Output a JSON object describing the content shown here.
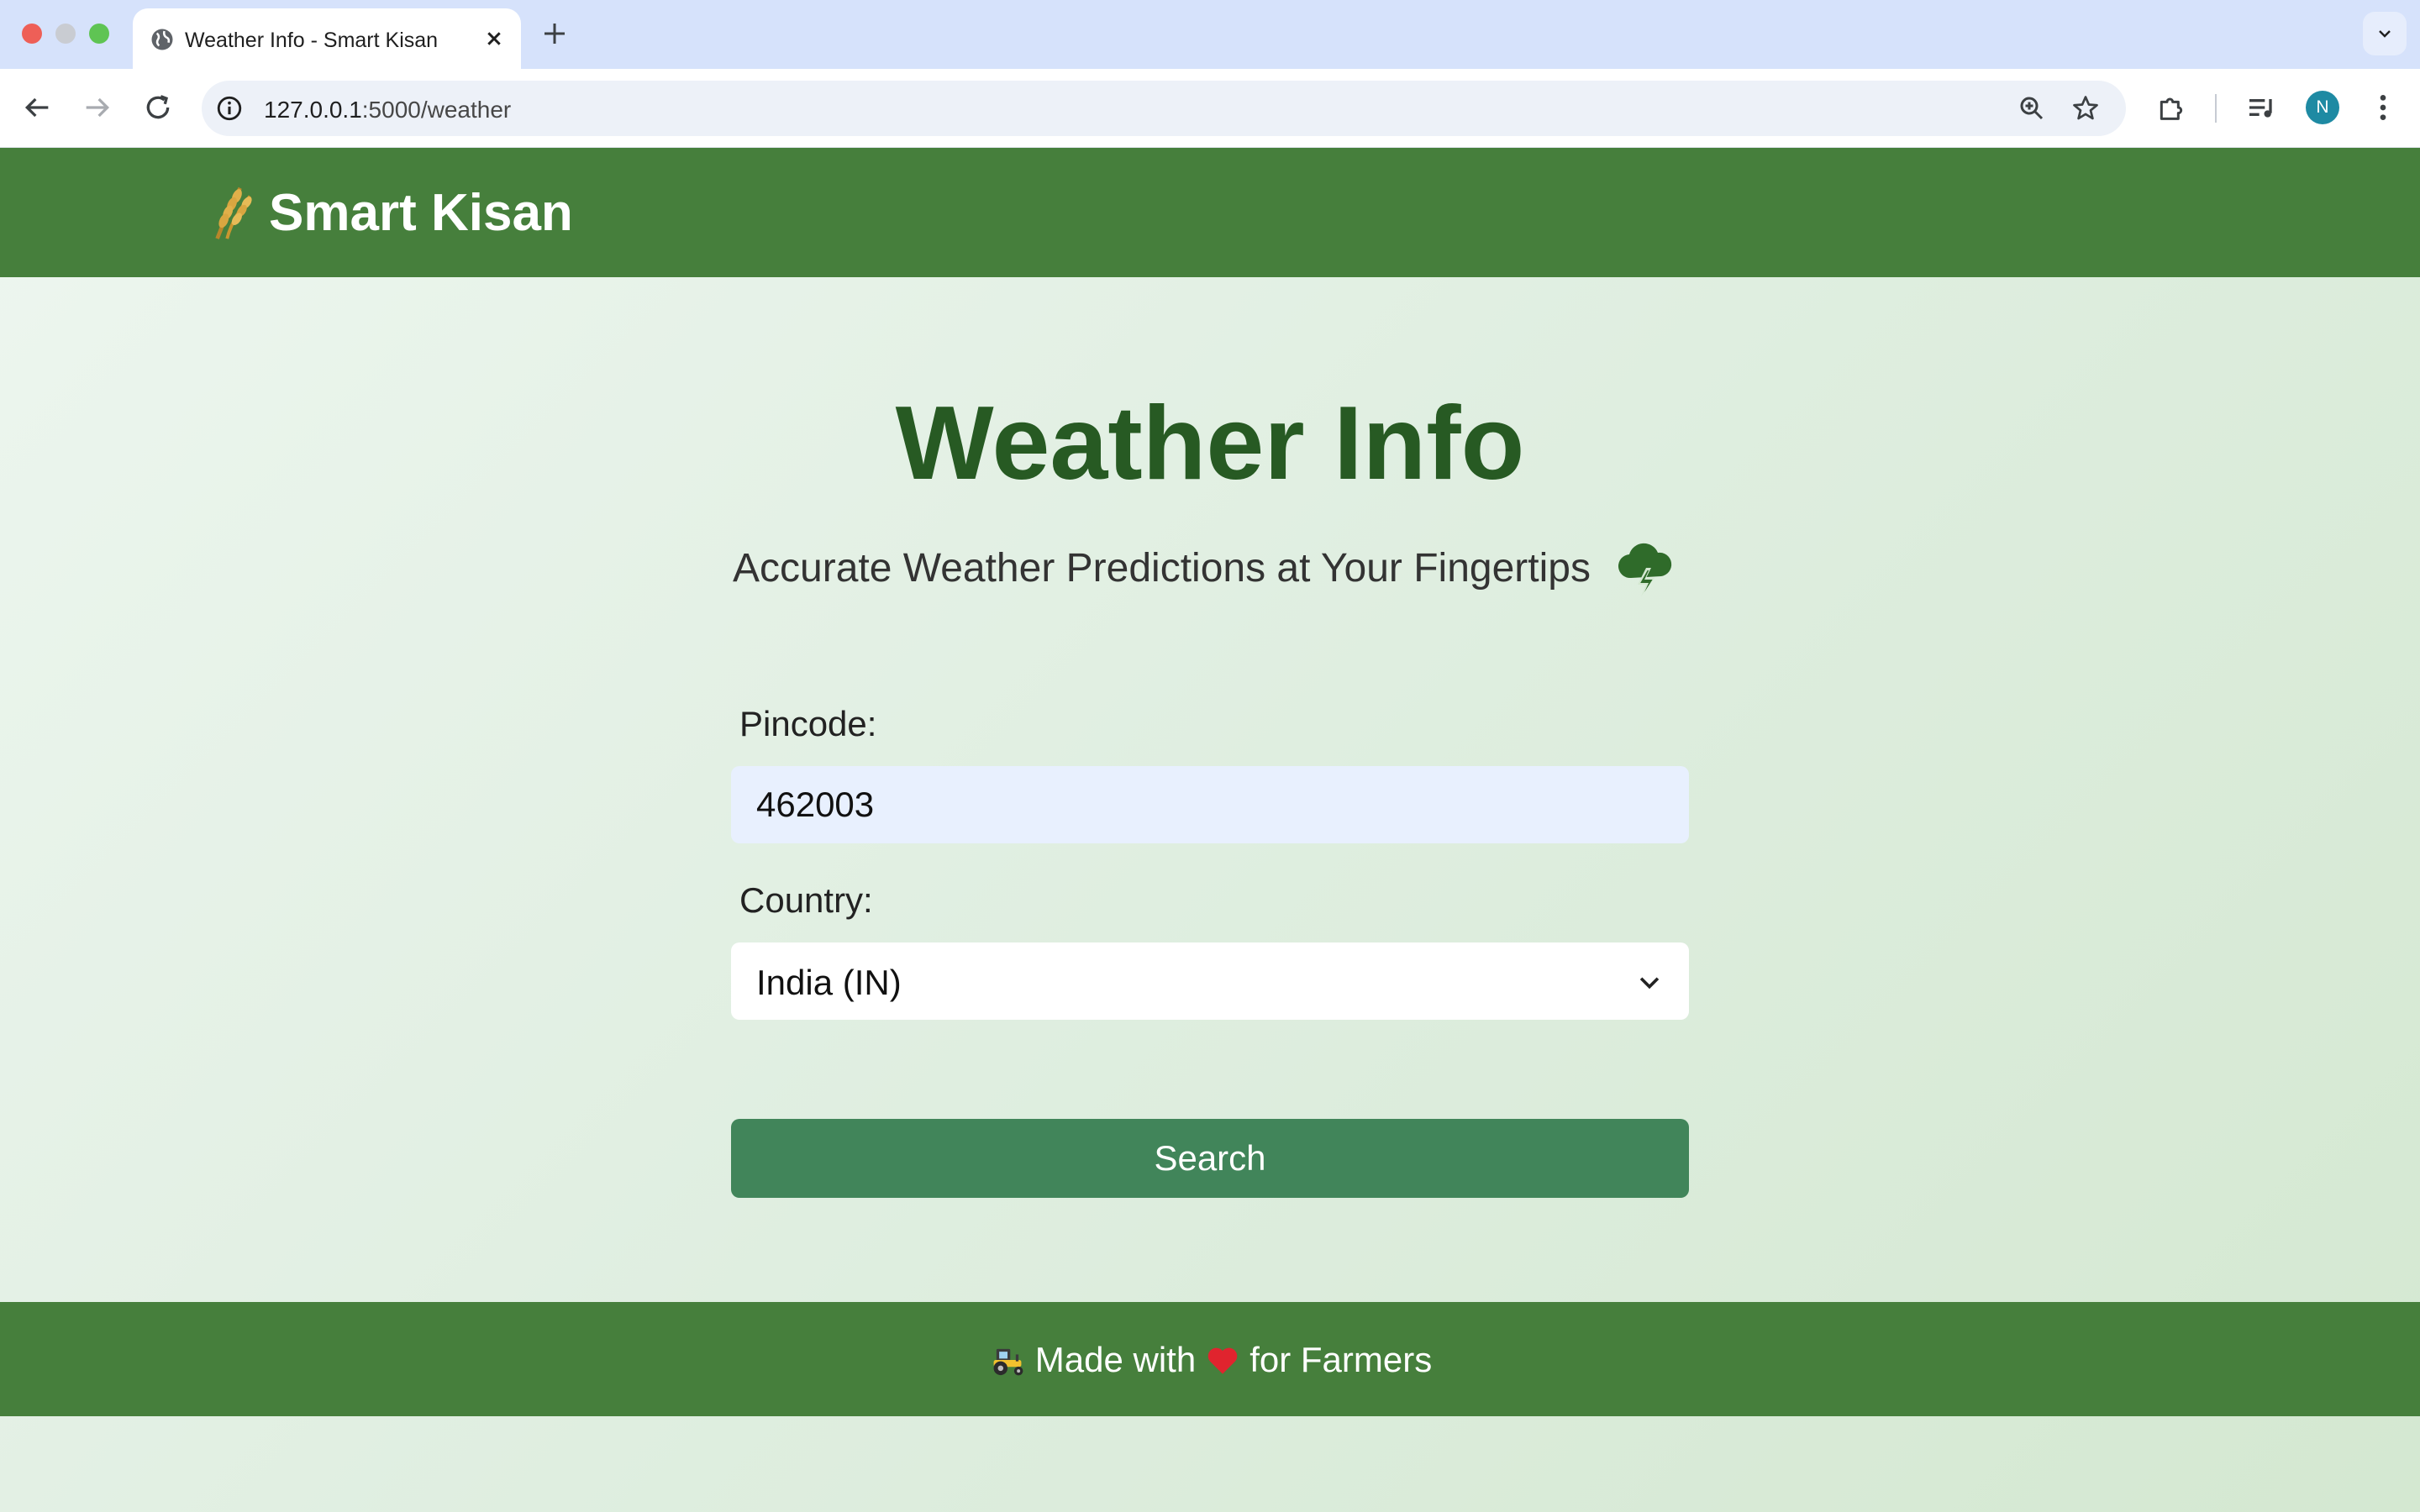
{
  "browser": {
    "tab_title": "Weather Info - Smart Kisan",
    "url_host": "127.0.0.1",
    "url_path": ":5000/weather",
    "profile_initial": "N"
  },
  "header": {
    "brand_name": "Smart Kisan",
    "logo_icon": "wheat-icon"
  },
  "main": {
    "title": "Weather Info",
    "subtitle": "Accurate Weather Predictions at Your Fingertips",
    "subtitle_icon": "storm-cloud-icon"
  },
  "form": {
    "pincode_label": "Pincode:",
    "pincode_value": "462003",
    "country_label": "Country:",
    "country_selected": "India (IN)",
    "search_label": "Search"
  },
  "footer": {
    "text_before": "Made with",
    "text_after": "for Farmers",
    "icons": [
      "tractor-icon",
      "heart-icon"
    ]
  },
  "colors": {
    "header_green": "#467f3c",
    "title_green": "#275a23",
    "button_green": "#41855a",
    "input_bg": "#e8f0fe"
  }
}
